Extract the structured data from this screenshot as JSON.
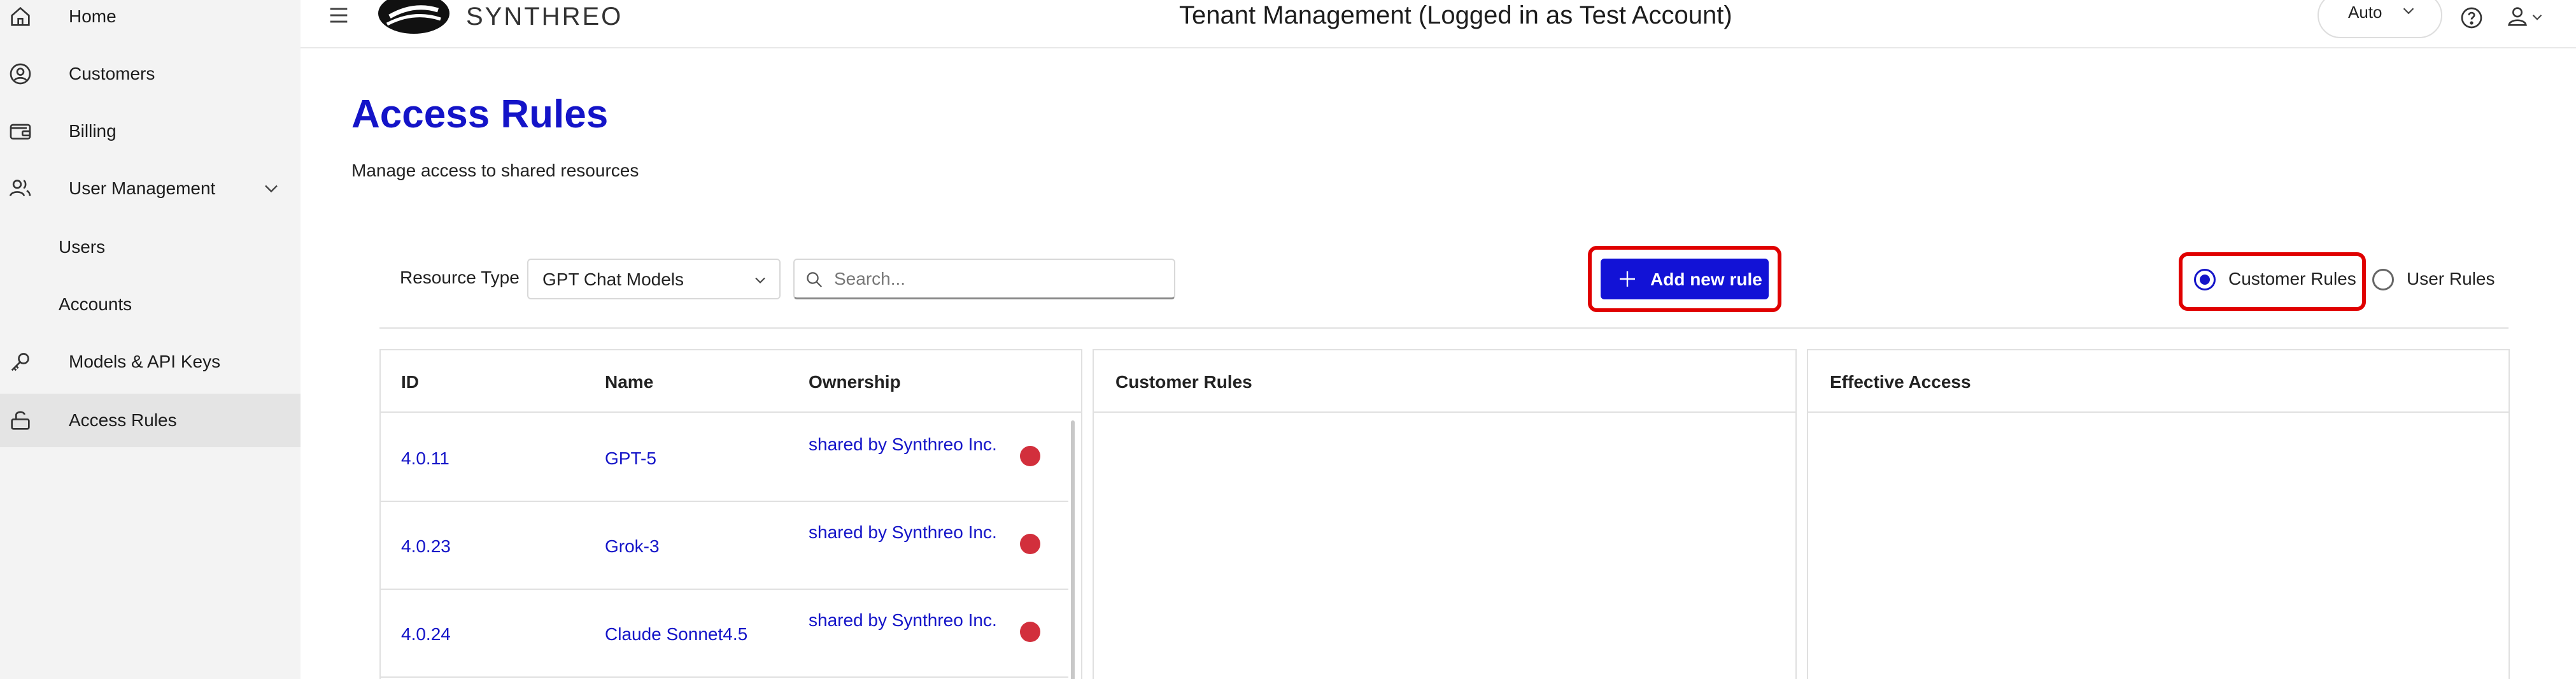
{
  "sidebar": {
    "items": [
      {
        "label": "Home",
        "icon": "home-icon"
      },
      {
        "label": "Customers",
        "icon": "user-circle-icon"
      },
      {
        "label": "Billing",
        "icon": "wallet-icon"
      },
      {
        "label": "User Management",
        "icon": "users-icon"
      },
      {
        "label": "Users"
      },
      {
        "label": "Accounts"
      },
      {
        "label": "Models & API Keys",
        "icon": "key-icon"
      },
      {
        "label": "Access Rules",
        "icon": "lock-icon"
      }
    ]
  },
  "header": {
    "brand": "SYNTHREO",
    "title": "Tenant Management (Logged in as Test Account)",
    "theme_value": "Auto"
  },
  "page": {
    "title": "Access Rules",
    "subtitle": "Manage access to shared resources"
  },
  "toolbar": {
    "resource_type_label": "Resource Type",
    "resource_type_value": "GPT Chat Models",
    "search_placeholder": "Search...",
    "add_button_label": "Add new rule",
    "radio_customer_label": "Customer Rules",
    "radio_user_label": "User Rules",
    "selected_mode": "Customer Rules"
  },
  "table": {
    "columns": [
      "ID",
      "Name",
      "Ownership"
    ],
    "rows": [
      {
        "id": "4.0.11",
        "name": "GPT-5",
        "ownership": "shared by Synthreo Inc."
      },
      {
        "id": "4.0.23",
        "name": "Grok-3",
        "ownership": "shared by Synthreo Inc."
      },
      {
        "id": "4.0.24",
        "name": "Claude Sonnet4.5",
        "ownership": "shared by Synthreo Inc."
      }
    ],
    "status_color": "#d22f3c"
  },
  "panels": {
    "customer_rules_title": "Customer Rules",
    "effective_access_title": "Effective Access"
  },
  "colors": {
    "accent": "#1414c8",
    "button": "#1212d6",
    "highlight": "#e00000"
  }
}
